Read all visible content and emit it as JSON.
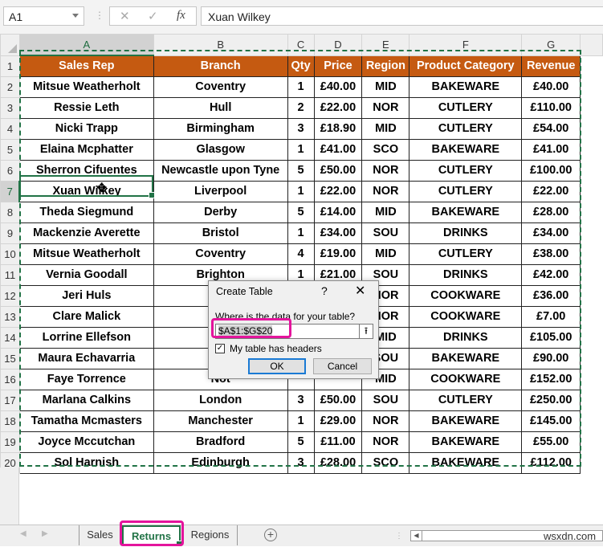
{
  "formula_bar": {
    "name_box": "A1",
    "cancel_icon": "✕",
    "enter_icon": "✓",
    "fx_label": "fx",
    "formula": "Xuan Wilkey"
  },
  "columns": [
    "A",
    "B",
    "C",
    "D",
    "E",
    "F",
    "G"
  ],
  "headers": [
    "Sales Rep",
    "Branch",
    "Qty",
    "Price",
    "Region",
    "Product Category",
    "Revenue"
  ],
  "rows": [
    [
      "Mitsue Weatherholt",
      "Coventry",
      "1",
      "£40.00",
      "MID",
      "BAKEWARE",
      "£40.00"
    ],
    [
      "Ressie Leth",
      "Hull",
      "2",
      "£22.00",
      "NOR",
      "CUTLERY",
      "£110.00"
    ],
    [
      "Nicki Trapp",
      "Birmingham",
      "3",
      "£18.90",
      "MID",
      "CUTLERY",
      "£54.00"
    ],
    [
      "Elaina Mcphatter",
      "Glasgow",
      "1",
      "£41.00",
      "SCO",
      "BAKEWARE",
      "£41.00"
    ],
    [
      "Sherron Cifuentes",
      "Newcastle upon Tyne",
      "5",
      "£50.00",
      "NOR",
      "CUTLERY",
      "£100.00"
    ],
    [
      "Xuan Wilkey",
      "Liverpool",
      "1",
      "£22.00",
      "NOR",
      "CUTLERY",
      "£22.00"
    ],
    [
      "Theda Siegmund",
      "Derby",
      "5",
      "£14.00",
      "MID",
      "BAKEWARE",
      "£28.00"
    ],
    [
      "Mackenzie Averette",
      "Bristol",
      "1",
      "£34.00",
      "SOU",
      "DRINKS",
      "£34.00"
    ],
    [
      "Mitsue Weatherholt",
      "Coventry",
      "4",
      "£19.00",
      "MID",
      "CUTLERY",
      "£38.00"
    ],
    [
      "Vernia Goodall",
      "Brighton",
      "1",
      "£21.00",
      "SOU",
      "DRINKS",
      "£42.00"
    ],
    [
      "Jeri Huls",
      "",
      "",
      "",
      "NOR",
      "COOKWARE",
      "£36.00"
    ],
    [
      "Clare Malick",
      "Wa",
      "",
      "",
      "NOR",
      "COOKWARE",
      "£7.00"
    ],
    [
      "Lorrine Ellefson",
      "Birm",
      "",
      "",
      "MID",
      "DRINKS",
      "£105.00"
    ],
    [
      "Maura Echavarria",
      "Lo",
      "",
      "",
      "SOU",
      "BAKEWARE",
      "£90.00"
    ],
    [
      "Faye Torrence",
      "Not",
      "",
      "",
      "MID",
      "COOKWARE",
      "£152.00"
    ],
    [
      "Marlana Calkins",
      "London",
      "3",
      "£50.00",
      "SOU",
      "CUTLERY",
      "£250.00"
    ],
    [
      "Tamatha Mcmasters",
      "Manchester",
      "1",
      "£29.00",
      "NOR",
      "BAKEWARE",
      "£145.00"
    ],
    [
      "Joyce Mccutchan",
      "Bradford",
      "5",
      "£11.00",
      "NOR",
      "BAKEWARE",
      "£55.00"
    ],
    [
      "Sol Harnish",
      "Edinburgh",
      "3",
      "£28.00",
      "SCO",
      "BAKEWARE",
      "£112.00"
    ]
  ],
  "dialog": {
    "title": "Create Table",
    "help": "?",
    "close": "✕",
    "prompt": "Where is the data for your table?",
    "range": "$A$1:$G$20",
    "collapse_icon": "⭱",
    "checkbox_label": "My table has headers",
    "checkbox_checked": true,
    "ok": "OK",
    "cancel": "Cancel"
  },
  "sheets": {
    "tabs": [
      "Sales",
      "Returns",
      "Regions"
    ],
    "active": "Returns",
    "add": "+"
  },
  "watermark": "wsxdn.com",
  "colors": {
    "header_fill": "#c55a11",
    "accent": "#217346",
    "highlight": "#e4149c"
  }
}
